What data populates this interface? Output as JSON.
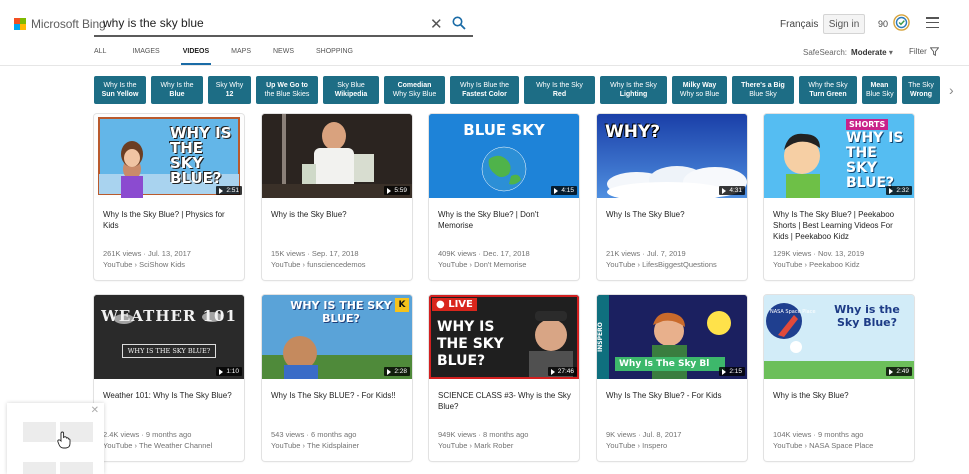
{
  "header": {
    "logo_text": "Microsoft Bing",
    "search_query": "why is the sky blue",
    "language_link": "Français",
    "signin_label": "Sign in",
    "rewards_points": "90"
  },
  "tabs": [
    {
      "label": "ALL",
      "active": false
    },
    {
      "label": "IMAGES",
      "active": false
    },
    {
      "label": "VIDEOS",
      "active": true
    },
    {
      "label": "MAPS",
      "active": false
    },
    {
      "label": "NEWS",
      "active": false
    },
    {
      "label": "SHOPPING",
      "active": false
    }
  ],
  "safesearch": {
    "label": "SafeSearch:",
    "value": "Moderate"
  },
  "filter_label": "Filter",
  "related": [
    {
      "line1": "Why Is the",
      "line2": "Sun Yellow",
      "bold": "none"
    },
    {
      "line1": "Why Is the",
      "line2": "Blue",
      "bold": "none"
    },
    {
      "line1": "Sky Why",
      "line2": "12",
      "bold": "none"
    },
    {
      "line1": "Up We Go to",
      "line2": "the Blue Skies",
      "bold": "line1"
    },
    {
      "line1": "Sky Blue",
      "line2": "Wikipedia",
      "bold": "line2"
    },
    {
      "line1": "Comedian",
      "line2": "Why Sky Blue",
      "bold": "line1"
    },
    {
      "line1": "Why Is Blue the",
      "line2": "Fastest Color",
      "bold": "line2"
    },
    {
      "line1": "Why Is the Sky",
      "line2": "Red",
      "bold": "line2"
    },
    {
      "line1": "Why Is the Sky",
      "line2": "Lighting",
      "bold": "line2"
    },
    {
      "line1": "Milky Way",
      "line2": "Why so Blue",
      "bold": "line1"
    },
    {
      "line1": "There's a Big",
      "line2": "Blue Sky",
      "bold": "line1"
    },
    {
      "line1": "Why the Sky",
      "line2": "Turn Green",
      "bold": "line2"
    },
    {
      "line1": "Mean",
      "line2": "Blue Sky",
      "bold": "line1"
    },
    {
      "line1": "The Sky",
      "line2": "Wrong",
      "bold": "line2"
    }
  ],
  "videos": [
    {
      "title": "Why Is the Sky Blue? | Physics for Kids",
      "views_date": "261K views · Jul. 13, 2017",
      "source": "YouTube › SciShow Kids",
      "duration": "2:51",
      "thumb_text": "WHY IS THE SKY BLUE?"
    },
    {
      "title": "Why is the Sky Blue?",
      "views_date": "15K views · Sep. 17, 2018",
      "source": "YouTube › funsciencedemos",
      "duration": "5:59",
      "thumb_text": ""
    },
    {
      "title": "Why is the Sky Blue? | Don't Memorise",
      "views_date": "409K views · Dec. 17, 2018",
      "source": "YouTube › Don't Memorise",
      "duration": "4:15",
      "thumb_text": "BLUE SKY"
    },
    {
      "title": "Why Is The Sky Blue?",
      "views_date": "21K views · Jul. 7, 2019",
      "source": "YouTube › LifesBiggestQuestions",
      "duration": "4:31",
      "thumb_text": "WHY?"
    },
    {
      "title": "Why Is The Sky Blue? | Peekaboo Shorts | Best Learning Videos For Kids | Peekaboo Kidz",
      "views_date": "129K views · Nov. 13, 2019",
      "source": "YouTube › Peekaboo Kidz",
      "duration": "2:32",
      "thumb_text": "WHY IS THE SKY BLUE?"
    },
    {
      "title": "Weather 101: Why Is The Sky Blue?",
      "views_date": "2.4K views · 9 months ago",
      "source": "YouTube › The Weather Channel",
      "duration": "1:10",
      "thumb_text": "WEATHER 101"
    },
    {
      "title": "Why Is The Sky BLUE? - For Kids!!",
      "views_date": "543 views · 6 months ago",
      "source": "YouTube › The Kidsplainer",
      "duration": "2:28",
      "thumb_text": "WHY IS THE SKY BLUE?"
    },
    {
      "title": "SCIENCE CLASS #3- Why is the Sky Blue?",
      "views_date": "949K views · 8 months ago",
      "source": "YouTube › Mark Rober",
      "duration": "27:46",
      "thumb_text": "WHY IS THE SKY BLUE?"
    },
    {
      "title": "Why Is The Sky Blue? - For Kids",
      "views_date": "9K views · Jul. 8, 2017",
      "source": "YouTube › Inspero",
      "duration": "2:15",
      "thumb_text": "Why Is The Sky Bl"
    },
    {
      "title": "Why is the Sky Blue?",
      "views_date": "104K views · 9 months ago",
      "source": "YouTube › NASA Space Place",
      "duration": "2:49",
      "thumb_text": "Why is the Sky Blue?"
    }
  ],
  "thumb_badges": {
    "shorts": "SHORTS",
    "live": "LIVE",
    "inspero": "INSPERO",
    "weather_sub": "WHY IS THE SKY BLUE?",
    "nasa": "NASA Space Place"
  },
  "colors": {
    "pill_bg": "#1d6d85",
    "active_tab_underline": "#1a6ba6"
  }
}
